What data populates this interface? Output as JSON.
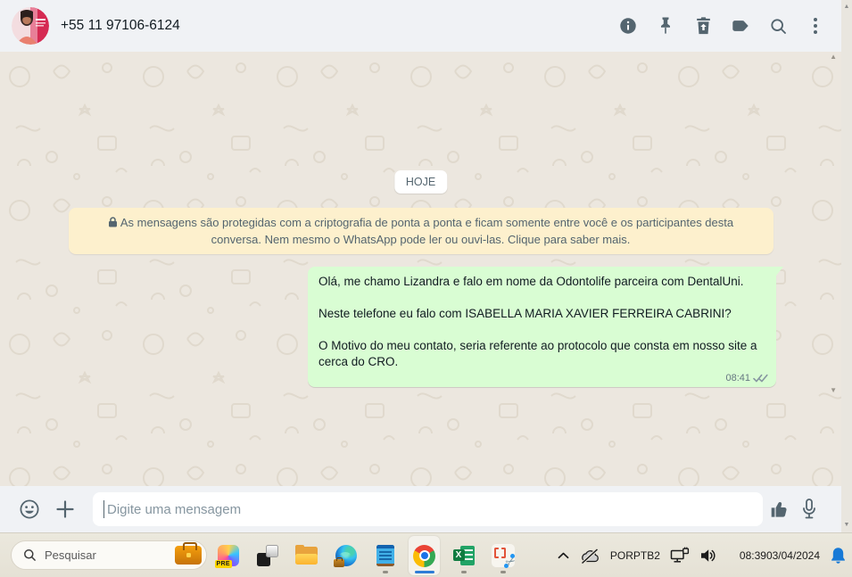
{
  "colors": {
    "header_bg": "#f0f2f5",
    "chat_bg": "#ece7df",
    "bubble_green": "#d9fdd3",
    "banner_yellow": "#fdf0cd",
    "icon_slate": "#54656f",
    "active_indicator_blue": "#2e7cd6",
    "bell_blue": "#1779d6"
  },
  "header": {
    "contact_name": "+55 11 97106-6124",
    "icons": [
      "info-icon",
      "pin-icon",
      "delete-icon",
      "label-icon",
      "search-icon",
      "menu-kebab-icon"
    ]
  },
  "chat": {
    "date_divider": "HOJE",
    "encryption_notice": "As mensagens são protegidas com a criptografia de ponta a ponta e ficam somente entre você e os participantes desta conversa. Nem mesmo o WhatsApp pode ler ou ouvi-las. Clique para saber mais.",
    "outgoing_message": {
      "paragraphs": [
        "Olá, me chamo Lizandra e falo em nome da Odontolife parceira com DentalUni.",
        "Neste telefone eu falo com ISABELLA MARIA XAVIER FERREIRA CABRINI?",
        "O Motivo do meu contato, seria referente ao protocolo que consta em nosso site a cerca do CRO."
      ],
      "time": "08:41",
      "status": "delivered-double-check"
    }
  },
  "composer": {
    "placeholder": "Digite uma mensagem",
    "icons": [
      "emoji-icon",
      "attach-plus-icon",
      "thumbs-up-icon",
      "mic-icon"
    ]
  },
  "taskbar": {
    "search": {
      "placeholder": "Pesquisar",
      "badge_icon": "briefcase-icon"
    },
    "apps": [
      {
        "name": "copilot",
        "badge": "PRE"
      },
      {
        "name": "task-view"
      },
      {
        "name": "file-explorer"
      },
      {
        "name": "edge-work-profile"
      },
      {
        "name": "notepad",
        "running": true
      },
      {
        "name": "chrome",
        "running": true,
        "active": true
      },
      {
        "name": "excel",
        "running": true
      },
      {
        "name": "snipping-tool",
        "running": true
      }
    ],
    "tray": {
      "hidden_icons": "chevron-up-icon",
      "onedrive": "cloud-off-icon",
      "language_line1": "POR",
      "language_line2": "PTB2",
      "network": "ethernet-icon",
      "volume": "speaker-icon",
      "time": "08:39",
      "date": "03/04/2024",
      "notifications": "bell-icon"
    }
  }
}
